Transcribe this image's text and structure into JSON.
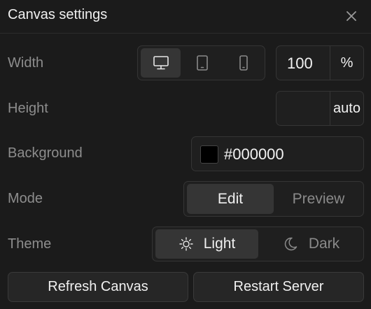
{
  "panel": {
    "title": "Canvas settings",
    "close_icon": "close-icon"
  },
  "width": {
    "label": "Width",
    "devices": [
      {
        "name": "desktop",
        "icon": "monitor-icon",
        "active": true
      },
      {
        "name": "tablet",
        "icon": "tablet-icon",
        "active": false
      },
      {
        "name": "mobile",
        "icon": "phone-icon",
        "active": false
      }
    ],
    "value": "100",
    "unit": "%"
  },
  "height": {
    "label": "Height",
    "value": "",
    "unit": "auto"
  },
  "background": {
    "label": "Background",
    "value": "#000000",
    "swatch_color": "#000000"
  },
  "mode": {
    "label": "Mode",
    "options": [
      "Edit",
      "Preview"
    ],
    "selected": "Edit"
  },
  "theme": {
    "label": "Theme",
    "options": [
      {
        "label": "Light",
        "icon": "sun-icon"
      },
      {
        "label": "Dark",
        "icon": "moon-icon"
      }
    ],
    "selected": "Light"
  },
  "actions": {
    "refresh_label": "Refresh Canvas",
    "restart_label": "Restart Server"
  },
  "colors": {
    "panel_bg": "#1b1b1b",
    "border": "#353535",
    "active_segment": "#353535",
    "label_text": "#8d8d8d"
  }
}
